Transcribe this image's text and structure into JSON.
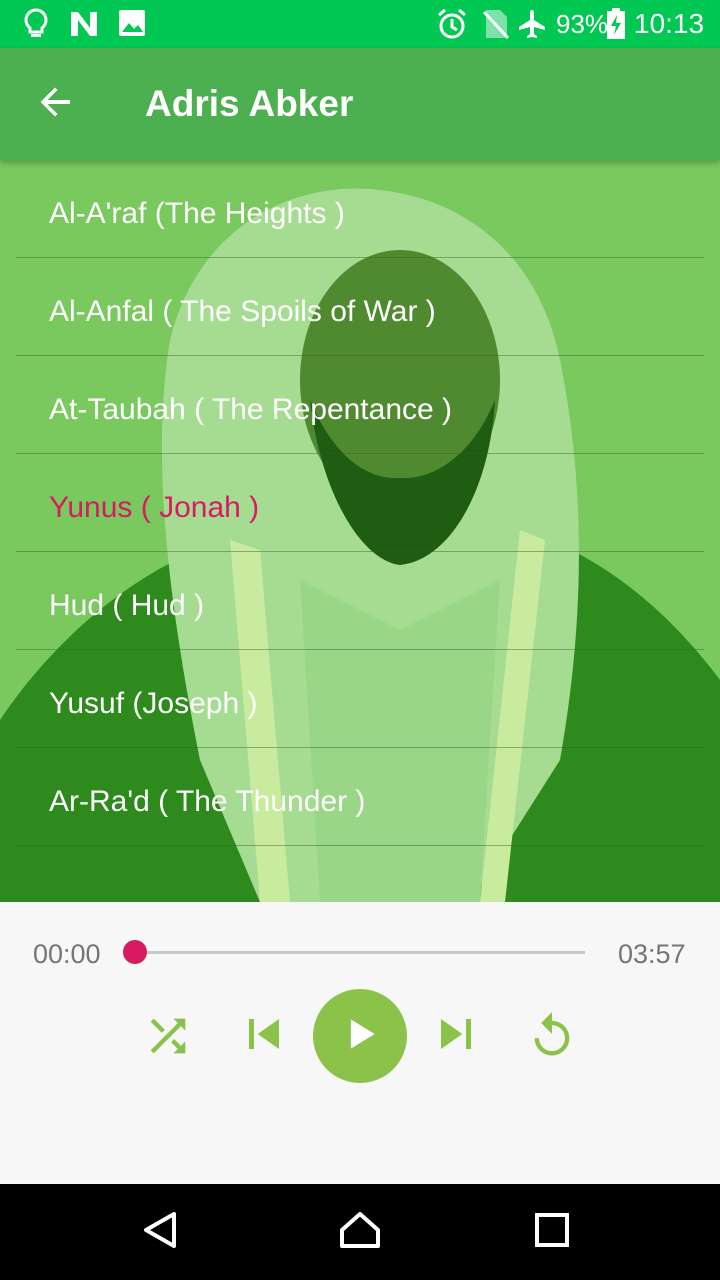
{
  "status_bar": {
    "battery_percent": "93%",
    "time": "10:13",
    "icons": [
      "lightbulb-icon",
      "n-logo-icon",
      "image-icon",
      "alarm-icon",
      "no-sim-icon",
      "airplane-icon",
      "battery-charging-icon"
    ]
  },
  "app_bar": {
    "title": "Adris Abker",
    "back_icon": "arrow-back-icon"
  },
  "tracks": [
    {
      "label": "Al-A'raf (The Heights )",
      "active": false
    },
    {
      "label": "Al-Anfal ( The Spoils of War )",
      "active": false
    },
    {
      "label": "At-Taubah ( The Repentance )",
      "active": false
    },
    {
      "label": "Yunus ( Jonah )",
      "active": true
    },
    {
      "label": "Hud ( Hud )",
      "active": false
    },
    {
      "label": "Yusuf (Joseph )",
      "active": false
    },
    {
      "label": "Ar-Ra'd ( The Thunder )",
      "active": false
    }
  ],
  "player": {
    "current_time": "00:00",
    "total_time": "03:57",
    "progress": 0,
    "controls": [
      "shuffle-icon",
      "skip-previous-icon",
      "play-icon",
      "skip-next-icon",
      "repeat-icon"
    ]
  },
  "colors": {
    "status_bar": "#00c853",
    "app_bar": "#4caf50",
    "accent": "#d81b60",
    "control_green": "#8bc34a"
  },
  "nav_bar": {
    "icons": [
      "back-triangle-icon",
      "home-icon",
      "recents-icon"
    ]
  }
}
